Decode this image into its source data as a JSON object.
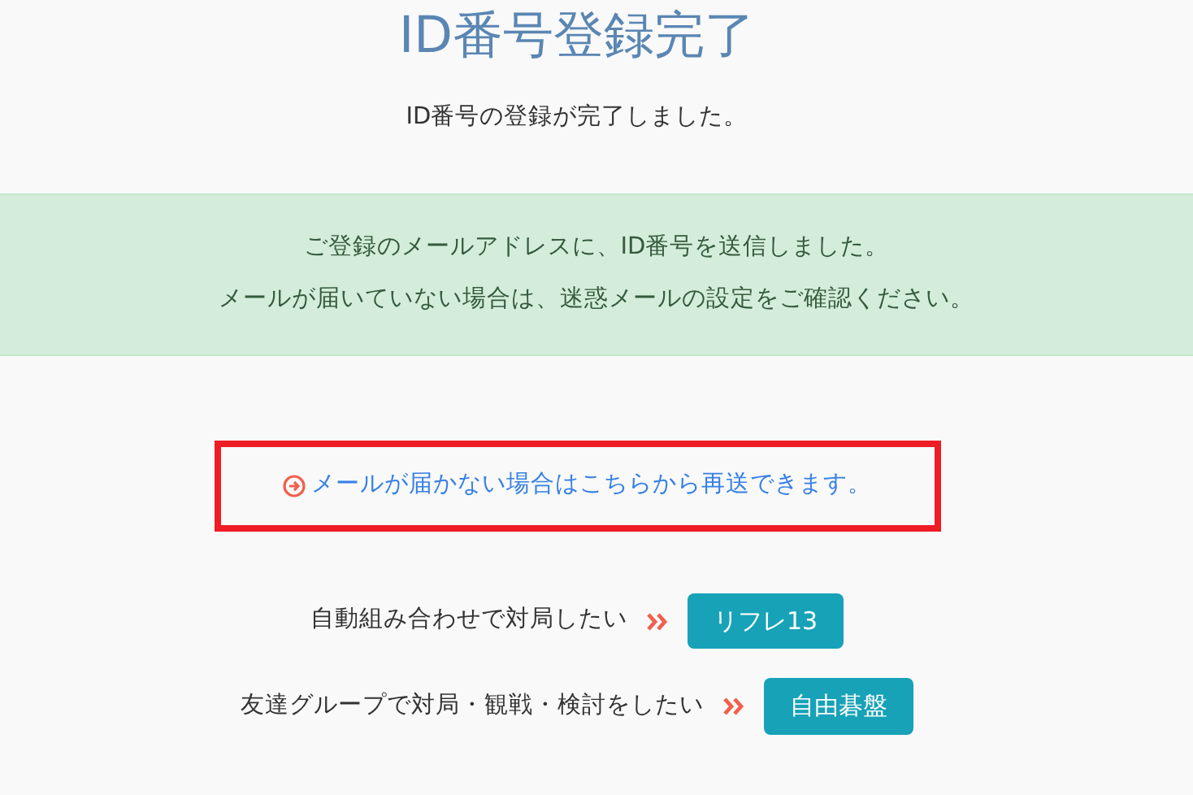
{
  "title": "ID番号登録完了",
  "subtitle": "ID番号の登録が完了しました。",
  "alert": {
    "lines": [
      "ご登録のメールアドレスに、ID番号を送信しました。",
      "メールが届いていない場合は、迷惑メールの設定をご確認ください。"
    ]
  },
  "resend_link": {
    "label": "メールが届かない場合はこちらから再送できます。",
    "highlighted": true
  },
  "actions": [
    {
      "label": "自動組み合わせで対局したい",
      "button": "リフレ13"
    },
    {
      "label": "友達グループで対局・観戦・検討をしたい",
      "button": "自由碁盤"
    }
  ]
}
